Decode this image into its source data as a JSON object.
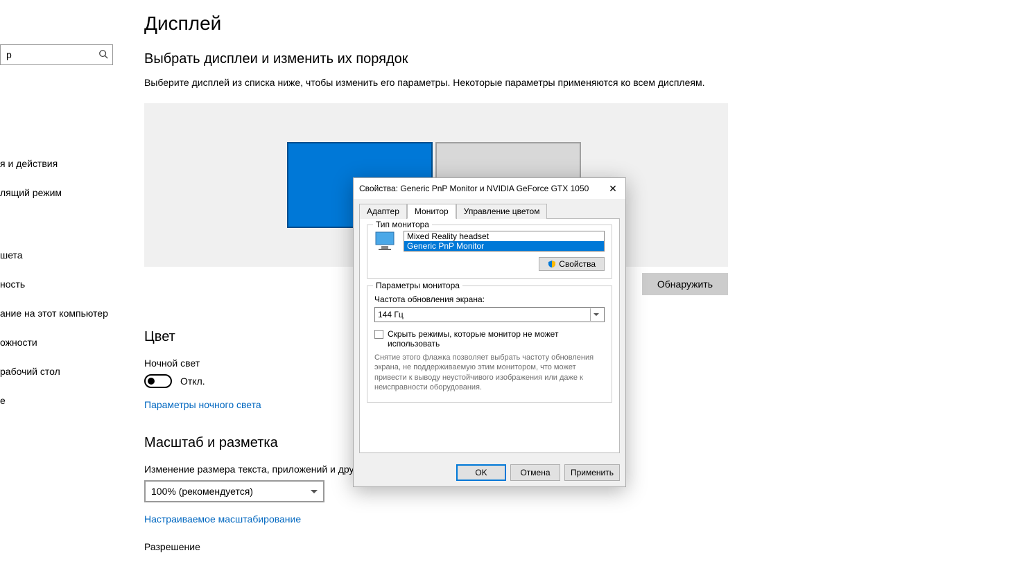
{
  "search": {
    "placeholder": "р"
  },
  "sidebar_items": [
    "я и действия",
    "лящий режим",
    "шета",
    "ность",
    "ание на этот компьютер",
    "ожности",
    "рабочий стол",
    "е"
  ],
  "page": {
    "title": "Дисплей",
    "section1_title": "Выбрать дисплеи и изменить их порядок",
    "section1_desc": "Выберите дисплей из списка ниже, чтобы изменить его параметры. Некоторые параметры применяются ко всем дисплеям.",
    "detect_button": "Обнаружить",
    "color_title": "Цвет",
    "night_light_label": "Ночной свет",
    "toggle_state": "Откл.",
    "night_light_link": "Параметры ночного света",
    "scale_title": "Масштаб и разметка",
    "scale_desc": "Изменение размера текста, приложений и других элементов",
    "scale_value": "100% (рекомендуется)",
    "custom_scaling_link": "Настраиваемое масштабирование",
    "resolution_label": "Разрешение"
  },
  "dialog": {
    "title": "Свойства: Generic PnP Monitor и NVIDIA GeForce GTX 1050",
    "close": "✕",
    "tabs": [
      "Адаптер",
      "Монитор",
      "Управление цветом"
    ],
    "active_tab": 1,
    "monitor_group": {
      "legend": "Тип монитора",
      "items": [
        "Mixed Reality headset",
        "Generic PnP Monitor"
      ],
      "selected": 1,
      "props_button": "Свойства"
    },
    "params_group": {
      "legend": "Параметры монитора",
      "refresh_label": "Частота обновления экрана:",
      "refresh_value": "144 Гц",
      "hide_checkbox_label": "Скрыть режимы, которые монитор не может использовать",
      "help_text": "Снятие этого флажка позволяет выбрать частоту обновления экрана, не поддерживаемую этим монитором, что может привести к выводу неустойчивого изображения или даже к неисправности оборудования."
    },
    "footer": {
      "ok": "OK",
      "cancel": "Отмена",
      "apply": "Применить"
    }
  }
}
